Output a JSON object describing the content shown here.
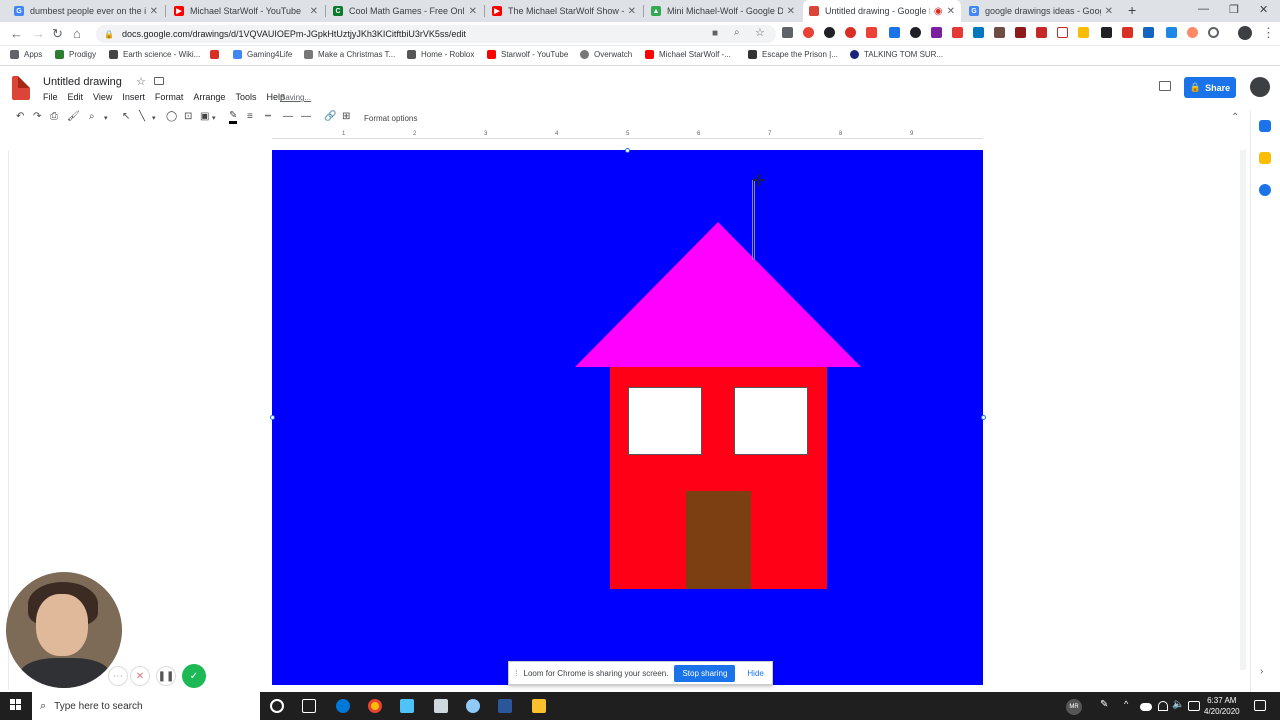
{
  "browser": {
    "tabs": [
      {
        "title": "dumbest people ever on the inte",
        "icon": "google-icon",
        "color": "#4285f4"
      },
      {
        "title": "Michael StarWolf - YouTube",
        "icon": "youtube-icon",
        "color": "#ff0000"
      },
      {
        "title": "Cool Math Games - Free Online I",
        "icon": "coolmath-icon",
        "color": "#0b7a2a"
      },
      {
        "title": "The Michael StarWolf Show - You",
        "icon": "youtube-icon",
        "color": "#ff0000"
      },
      {
        "title": "Mini Michael-Wolf - Google Driv",
        "icon": "drive-icon",
        "color": "#34a853"
      },
      {
        "title": "Untitled drawing - Google D",
        "icon": "drawings-icon",
        "color": "#db4437",
        "active": true
      },
      {
        "title": "google drawings ideas - Google",
        "icon": "google-icon",
        "color": "#4285f4"
      }
    ],
    "new_tab": "+",
    "url": "docs.google.com/drawings/d/1VQVAUIOEPm-JGpkHtUztjyJKh3KICitftbiU3rVK5ss/edit",
    "bookmarks": [
      {
        "label": "Apps",
        "icon": "apps-grid-icon",
        "color": "#5f6368"
      },
      {
        "label": "Prodigy",
        "icon": "prodigy-icon",
        "color": "#2e7d32"
      },
      {
        "label": "Earth science - Wiki...",
        "icon": "wikipedia-icon",
        "color": "#444444"
      },
      {
        "label": "",
        "icon": "gmail-icon",
        "color": "#d93025"
      },
      {
        "label": "Gaming4Life",
        "icon": "bookmark-icon",
        "color": "#4285f4"
      },
      {
        "label": "Make a Christmas T...",
        "icon": "bookmark-icon",
        "color": "#777777"
      },
      {
        "label": "Home - Roblox",
        "icon": "roblox-icon",
        "color": "#555555"
      },
      {
        "label": "Starwolf - YouTube",
        "icon": "youtube-icon",
        "color": "#ff0000"
      },
      {
        "label": "Overwatch",
        "icon": "overwatch-icon",
        "color": "#777777"
      },
      {
        "label": "Michael StarWolf -...",
        "icon": "youtube-icon",
        "color": "#ff0000"
      },
      {
        "label": "Escape the Prison |...",
        "icon": "bookmark-icon",
        "color": "#333333"
      },
      {
        "label": "TALKING TOM SUR...",
        "icon": "bookmark-icon",
        "color": "#1a237e"
      }
    ]
  },
  "docs": {
    "title": "Untitled drawing",
    "menu": [
      "File",
      "Edit",
      "View",
      "Insert",
      "Format",
      "Arrange",
      "Tools",
      "Help"
    ],
    "status": "Saving...",
    "share_label": "Share",
    "format_options": "Format options",
    "ruler": [
      "1",
      "2",
      "3",
      "4",
      "5",
      "6",
      "7",
      "8",
      "9"
    ]
  },
  "drawing": {
    "background": "#0000ff",
    "roof_color": "#ff00ff",
    "wall_color": "#ff0016",
    "window_color": "#ffffff",
    "door_color": "#7b3f12"
  },
  "loom": {
    "message": "Loom for Chrome is sharing your screen.",
    "stop_label": "Stop sharing",
    "hide_label": "Hide"
  },
  "taskbar": {
    "search_placeholder": "Type here to search",
    "user_initials": "MR",
    "time": "6:37 AM",
    "date": "4/20/2020"
  }
}
